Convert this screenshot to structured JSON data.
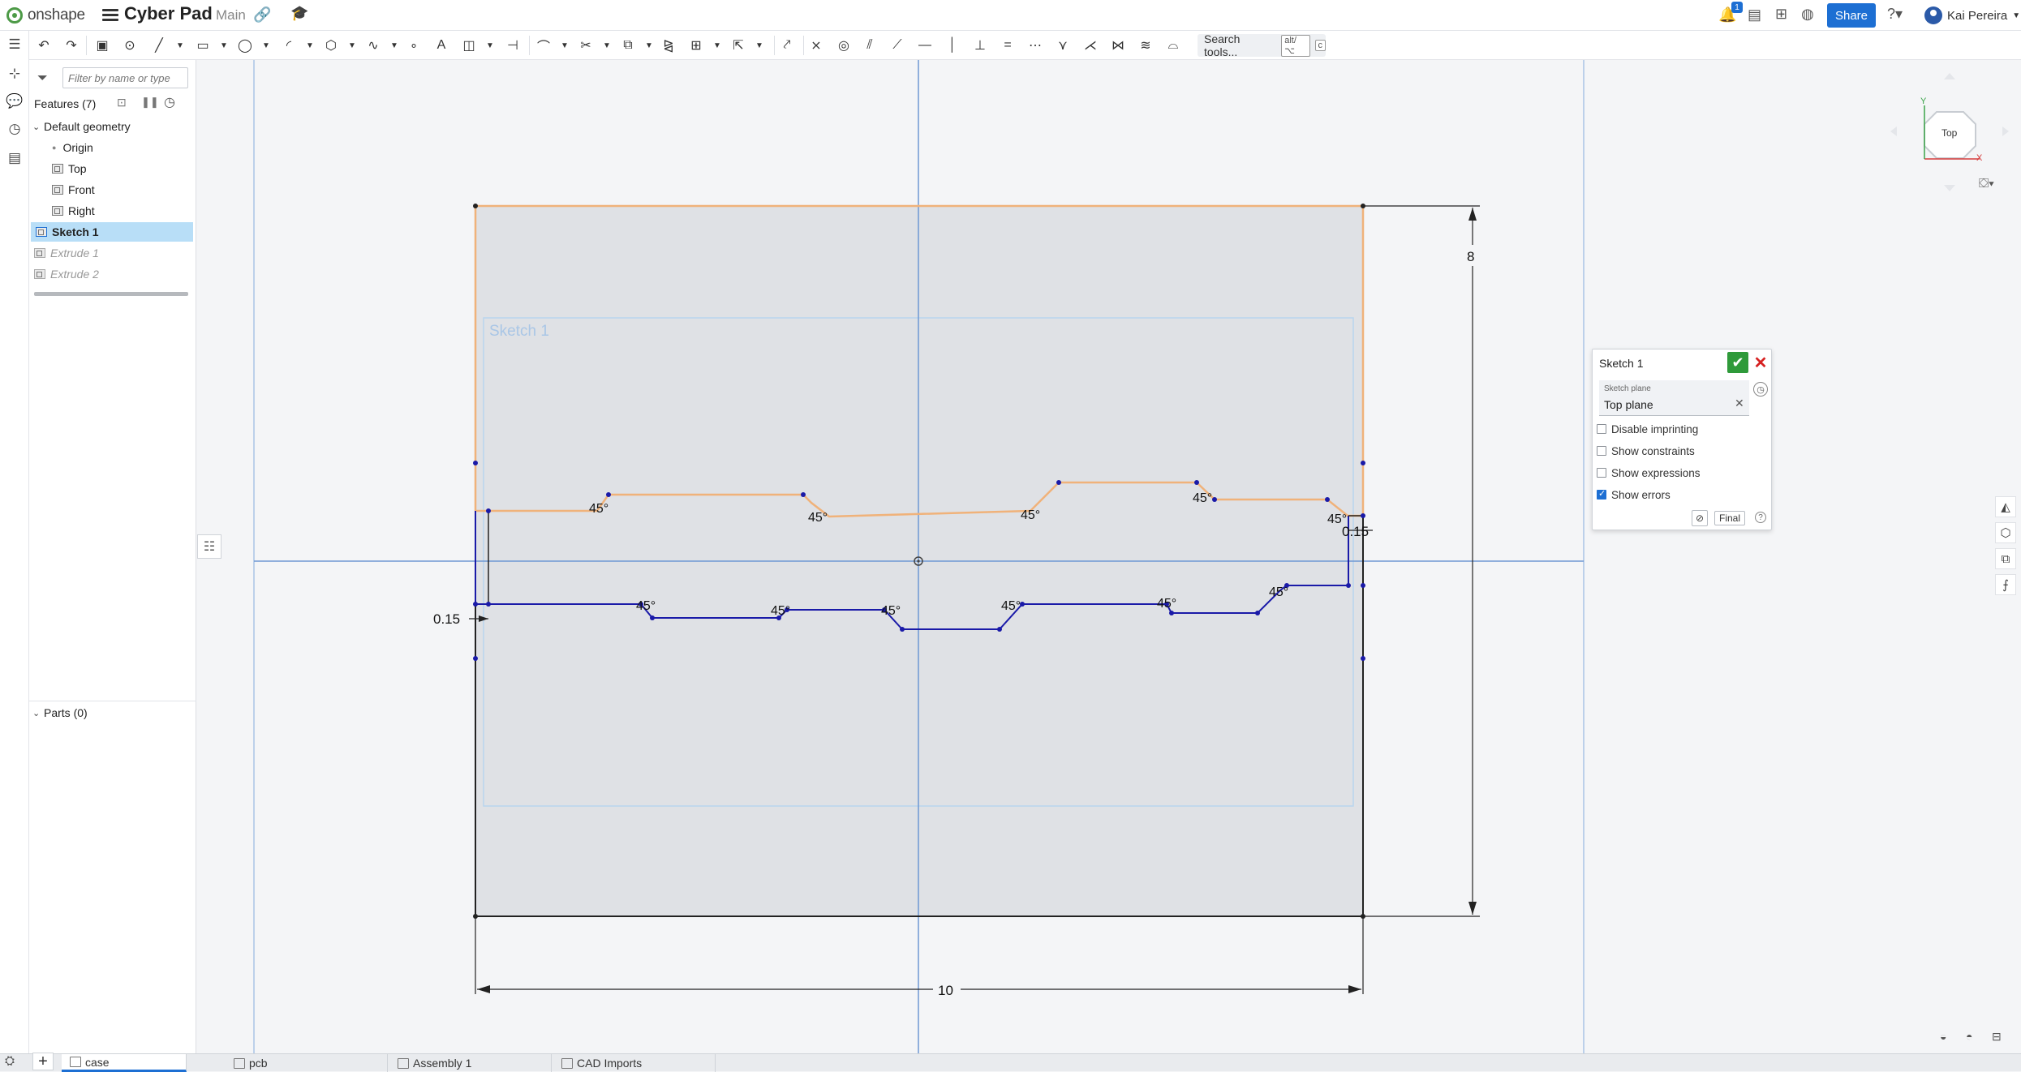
{
  "app": {
    "brand": "onshape",
    "document_title": "Cyber Pad",
    "branch": "Main",
    "notification_count": "1",
    "share_label": "Share",
    "user_name": "Kai Pereira",
    "search_tools": "Search tools...",
    "search_shortcut": "alt/⌥",
    "search_shortcut_key": "c"
  },
  "feature_panel": {
    "filter_placeholder": "Filter by name or type",
    "features_header": "Features (7)",
    "default_geometry": "Default geometry",
    "items": [
      {
        "label": "Origin",
        "icon": "origin-icon"
      },
      {
        "label": "Top",
        "icon": "plane-icon"
      },
      {
        "label": "Front",
        "icon": "plane-icon"
      },
      {
        "label": "Right",
        "icon": "plane-icon"
      },
      {
        "label": "Sketch 1",
        "icon": "sketch-icon",
        "selected": true
      },
      {
        "label": "Extrude 1",
        "icon": "extrude-icon",
        "suppressed": true
      },
      {
        "label": "Extrude 2",
        "icon": "extrude-icon",
        "suppressed": true
      }
    ],
    "parts_header": "Parts (0)"
  },
  "canvas": {
    "sketch_label": "Sketch 1",
    "dimensions": {
      "width": "10",
      "height": "8",
      "offset_left": "0.15",
      "offset_right": "0.15",
      "angle": "45°"
    },
    "view_cube_label": "Top",
    "axis_x": "X",
    "axis_y": "Y"
  },
  "sketch_dialog": {
    "title": "Sketch 1",
    "plane_label": "Sketch plane",
    "plane_value": "Top plane",
    "options": [
      {
        "label": "Disable imprinting",
        "checked": false
      },
      {
        "label": "Show constraints",
        "checked": false
      },
      {
        "label": "Show expressions",
        "checked": false
      },
      {
        "label": "Show errors",
        "checked": true
      }
    ],
    "final_label": "Final"
  },
  "tabs": [
    {
      "label": "case",
      "active": true
    },
    {
      "label": "pcb",
      "active": false
    },
    {
      "label": "Assembly 1",
      "active": false
    },
    {
      "label": "CAD Imports",
      "active": false
    }
  ],
  "colors": {
    "accent": "#1d6fd3",
    "sketch_selected": "#f0b27a",
    "sketch_line": "#1a1aa8",
    "confirm": "#2f9a3a",
    "cancel": "#d62020"
  }
}
